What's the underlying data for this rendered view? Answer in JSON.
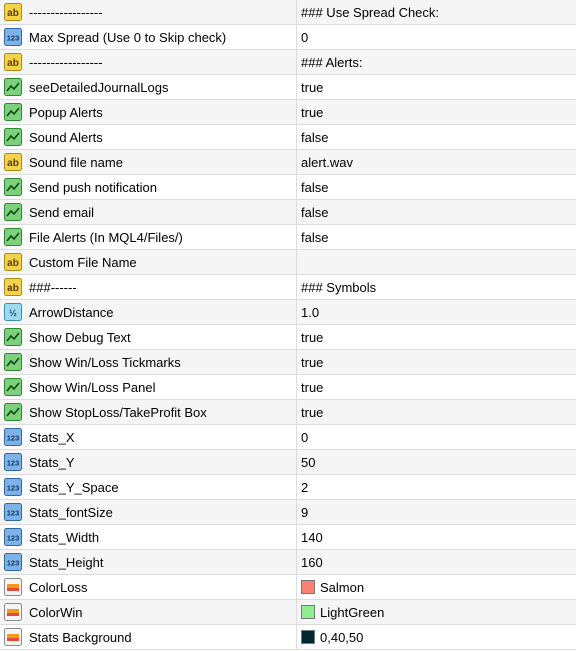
{
  "rows": [
    {
      "icon": "string-icon",
      "name": "-----------------",
      "value": "### Use Spread Check:"
    },
    {
      "icon": "integer-icon",
      "name": "Max Spread (Use 0 to Skip check)",
      "value": "0"
    },
    {
      "icon": "string-icon",
      "name": "-----------------",
      "value": "### Alerts:"
    },
    {
      "icon": "bool-icon",
      "name": "seeDetailedJournalLogs",
      "value": "true"
    },
    {
      "icon": "bool-icon",
      "name": "Popup Alerts",
      "value": "true"
    },
    {
      "icon": "bool-icon",
      "name": "Sound Alerts",
      "value": "false"
    },
    {
      "icon": "string-icon",
      "name": "Sound file name",
      "value": "alert.wav"
    },
    {
      "icon": "bool-icon",
      "name": "Send push notification",
      "value": "false"
    },
    {
      "icon": "bool-icon",
      "name": "Send email",
      "value": "false"
    },
    {
      "icon": "bool-icon",
      "name": "File Alerts (In MQL4/Files/)",
      "value": "false"
    },
    {
      "icon": "string-icon",
      "name": "Custom File Name",
      "value": ""
    },
    {
      "icon": "string-icon",
      "name": "###------",
      "value": "### Symbols"
    },
    {
      "icon": "double-icon",
      "name": "ArrowDistance",
      "value": "1.0"
    },
    {
      "icon": "bool-icon",
      "name": "Show Debug Text",
      "value": "true"
    },
    {
      "icon": "bool-icon",
      "name": "Show Win/Loss Tickmarks",
      "value": "true"
    },
    {
      "icon": "bool-icon",
      "name": "Show Win/Loss Panel",
      "value": "true"
    },
    {
      "icon": "bool-icon",
      "name": "Show StopLoss/TakeProfit Box",
      "value": "true"
    },
    {
      "icon": "integer-icon",
      "name": "Stats_X",
      "value": "0"
    },
    {
      "icon": "integer-icon",
      "name": "Stats_Y",
      "value": "50"
    },
    {
      "icon": "integer-icon",
      "name": "Stats_Y_Space",
      "value": "2"
    },
    {
      "icon": "integer-icon",
      "name": "Stats_fontSize",
      "value": "9"
    },
    {
      "icon": "integer-icon",
      "name": "Stats_Width",
      "value": "140"
    },
    {
      "icon": "integer-icon",
      "name": "Stats_Height",
      "value": "160"
    },
    {
      "icon": "color-icon",
      "name": "ColorLoss",
      "value": "Salmon",
      "swatch": "#fa8072"
    },
    {
      "icon": "color-icon",
      "name": "ColorWin",
      "value": "LightGreen",
      "swatch": "#90ee90"
    },
    {
      "icon": "color-icon",
      "name": "Stats Background",
      "value": "0,40,50",
      "swatch": "#00282f"
    }
  ]
}
